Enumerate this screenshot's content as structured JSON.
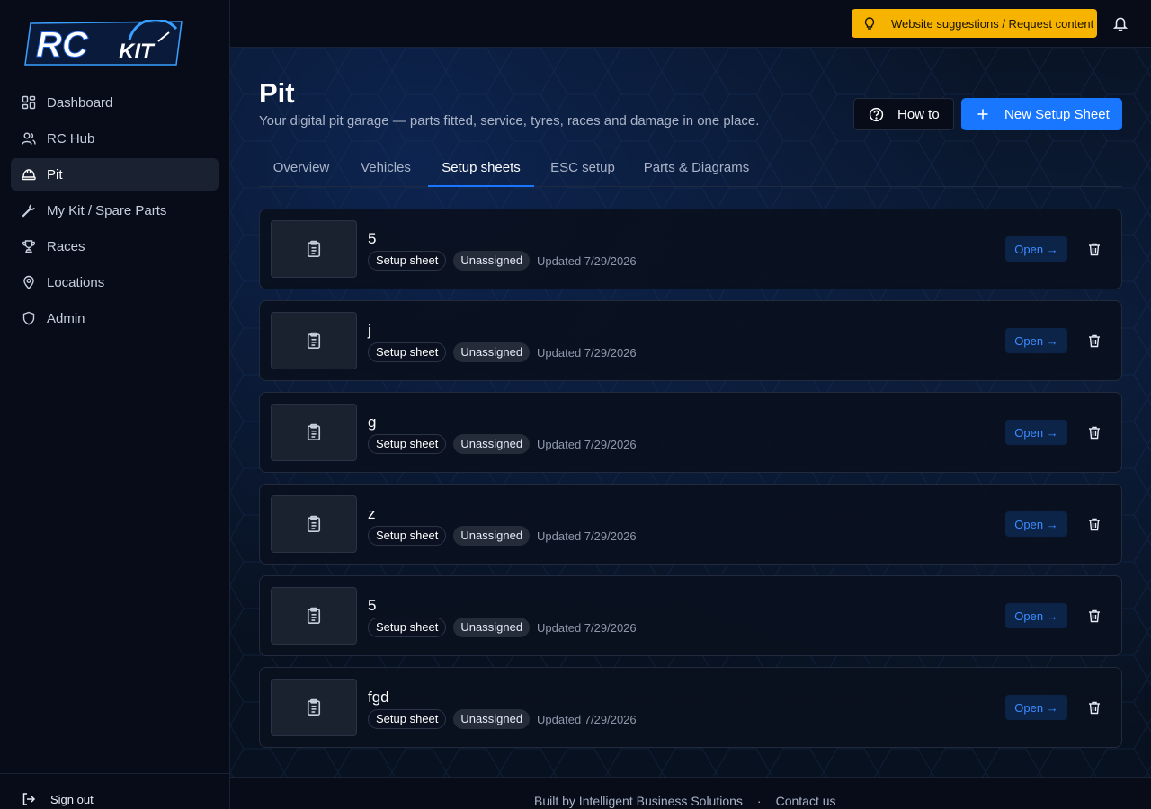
{
  "brand": {
    "logo_text_main": "RC",
    "logo_text_sub": "KIT"
  },
  "sidebar": {
    "items": [
      {
        "label": "Dashboard",
        "icon": "dashboard-icon"
      },
      {
        "label": "RC Hub",
        "icon": "users-icon"
      },
      {
        "label": "Pit",
        "icon": "hardhat-icon",
        "active": true
      },
      {
        "label": "My Kit / Spare Parts",
        "icon": "wrench-icon"
      },
      {
        "label": "Races",
        "icon": "trophy-icon"
      },
      {
        "label": "Locations",
        "icon": "map-pin-icon"
      },
      {
        "label": "Admin",
        "icon": "shield-icon"
      }
    ],
    "signout_label": "Sign out"
  },
  "topbar": {
    "suggest_label": "Website suggestions / Request content",
    "accent": "#f6b400"
  },
  "page": {
    "title": "Pit",
    "subtitle": "Your digital pit garage — parts fitted, service, tyres, races and damage in one place.",
    "howto_label": "How to",
    "new_label": "New Setup Sheet",
    "primary_color": "#1876ff"
  },
  "tabs": [
    {
      "label": "Overview"
    },
    {
      "label": "Vehicles"
    },
    {
      "label": "Setup sheets",
      "active": true
    },
    {
      "label": "ESC setup"
    },
    {
      "label": "Parts & Diagrams"
    }
  ],
  "sheets": [
    {
      "title": "5",
      "type": "Setup sheet",
      "status": "Unassigned",
      "updated": "Updated 7/29/2026",
      "open_label": "Open →"
    },
    {
      "title": "j",
      "type": "Setup sheet",
      "status": "Unassigned",
      "updated": "Updated 7/29/2026",
      "open_label": "Open →"
    },
    {
      "title": "g",
      "type": "Setup sheet",
      "status": "Unassigned",
      "updated": "Updated 7/29/2026",
      "open_label": "Open →"
    },
    {
      "title": "z",
      "type": "Setup sheet",
      "status": "Unassigned",
      "updated": "Updated 7/29/2026",
      "open_label": "Open →"
    },
    {
      "title": "5",
      "type": "Setup sheet",
      "status": "Unassigned",
      "updated": "Updated 7/29/2026",
      "open_label": "Open →"
    },
    {
      "title": "fgd",
      "type": "Setup sheet",
      "status": "Unassigned",
      "updated": "Updated 7/29/2026",
      "open_label": "Open →"
    }
  ],
  "footer": {
    "built_by": "Built by Intelligent Business Solutions",
    "separator": "·",
    "contact": "Contact us"
  }
}
